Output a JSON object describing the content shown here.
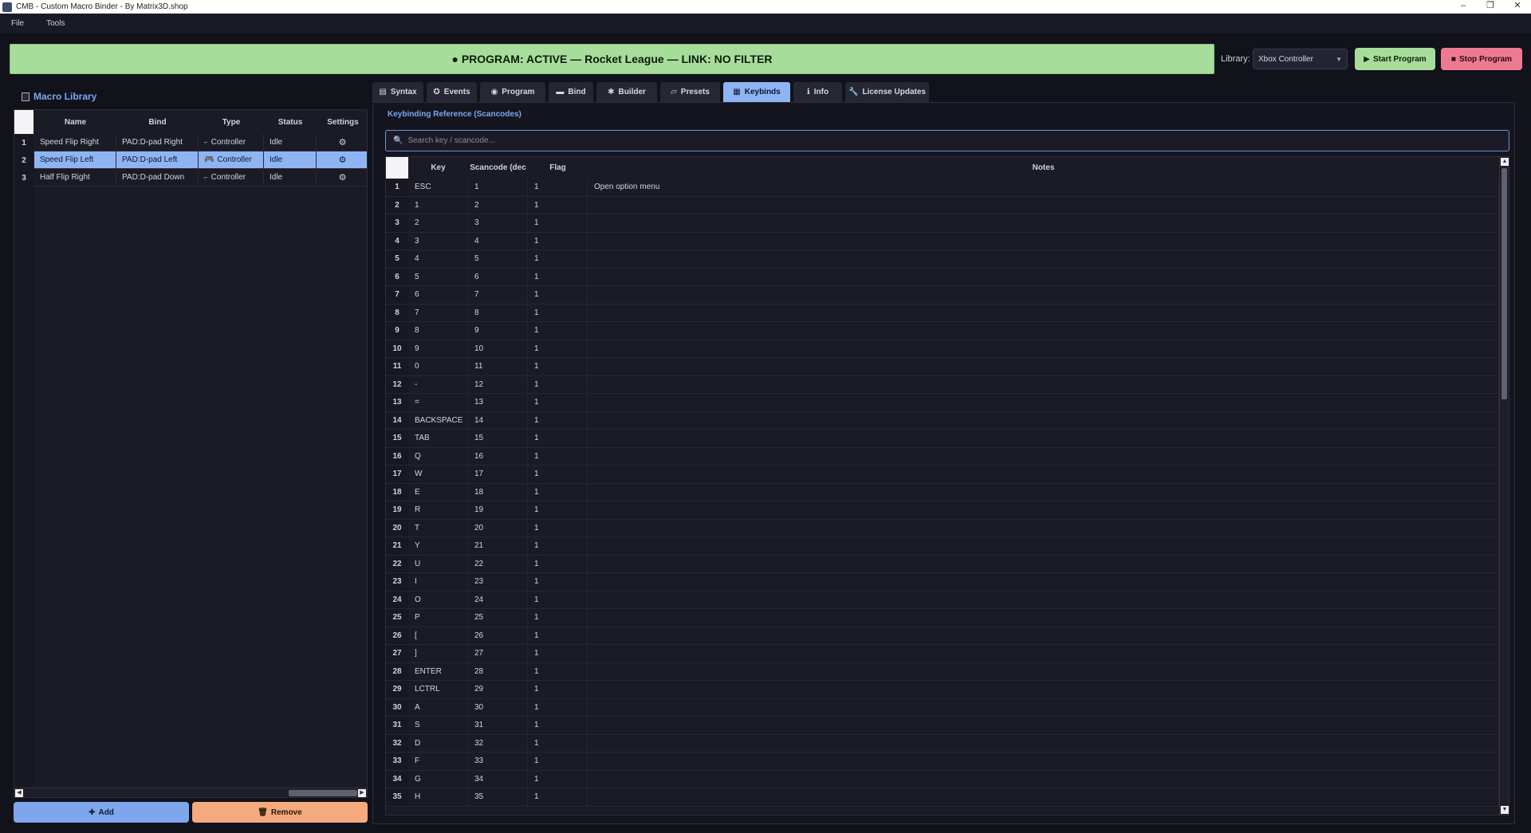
{
  "window": {
    "title": "CMB - Custom Macro Binder - By Matrix3D.shop",
    "controls": [
      "–",
      "❐",
      "✕"
    ]
  },
  "menu": [
    "File",
    "Tools"
  ],
  "status": {
    "text": "● PROGRAM: ACTIVE — Rocket League — LINK: NO FILTER",
    "color": "#a7dd9a"
  },
  "library_selector": {
    "label": "Library:",
    "value": "Xbox Controller"
  },
  "buttons": {
    "start": "Start Program",
    "stop": "Stop Program",
    "add": "Add",
    "remove": "Remove"
  },
  "macro_library": {
    "title": "Macro Library",
    "columns": [
      "Name",
      "Bind",
      "Type",
      "Status",
      "Settings"
    ],
    "rows": [
      {
        "num": "1",
        "name": "Speed Flip Right",
        "bind": "PAD:D-pad Right",
        "type": "Controller",
        "status": "Idle",
        "selected": false
      },
      {
        "num": "2",
        "name": "Speed Flip Left",
        "bind": "PAD:D-pad Left",
        "type": "Controller",
        "status": "Idle",
        "selected": true
      },
      {
        "num": "3",
        "name": "Half Flip Right",
        "bind": "PAD:D-pad Down",
        "type": "Controller",
        "status": "Idle",
        "selected": false
      }
    ]
  },
  "tabs": [
    {
      "label": "Syntax",
      "icon": "▤",
      "active": false
    },
    {
      "label": "Events",
      "icon": "✪",
      "active": false
    },
    {
      "label": "Program",
      "icon": "◉",
      "active": false
    },
    {
      "label": "Bind",
      "icon": "▬",
      "active": false
    },
    {
      "label": "Builder",
      "icon": "✱",
      "active": false
    },
    {
      "label": "Presets",
      "icon": "▱",
      "active": false
    },
    {
      "label": "Keybinds",
      "icon": "▦",
      "active": true
    },
    {
      "label": "Info",
      "icon": "ℹ",
      "active": false
    },
    {
      "label": "License  Updates",
      "icon": "🔧",
      "active": false
    }
  ],
  "keybinds": {
    "group_title": "Keybinding Reference (Scancodes)",
    "search_placeholder": "Search key / scancode...",
    "columns": [
      "Key",
      "Scancode (dec",
      "Flag",
      "Notes"
    ],
    "rows": [
      [
        "1",
        "ESC",
        "1",
        "1",
        "Open option menu"
      ],
      [
        "2",
        "1",
        "2",
        "1",
        ""
      ],
      [
        "3",
        "2",
        "3",
        "1",
        ""
      ],
      [
        "4",
        "3",
        "4",
        "1",
        ""
      ],
      [
        "5",
        "4",
        "5",
        "1",
        ""
      ],
      [
        "6",
        "5",
        "6",
        "1",
        ""
      ],
      [
        "7",
        "6",
        "7",
        "1",
        ""
      ],
      [
        "8",
        "7",
        "8",
        "1",
        ""
      ],
      [
        "9",
        "8",
        "9",
        "1",
        ""
      ],
      [
        "10",
        "9",
        "10",
        "1",
        ""
      ],
      [
        "11",
        "0",
        "11",
        "1",
        ""
      ],
      [
        "12",
        "-",
        "12",
        "1",
        ""
      ],
      [
        "13",
        "=",
        "13",
        "1",
        ""
      ],
      [
        "14",
        "BACKSPACE",
        "14",
        "1",
        ""
      ],
      [
        "15",
        "TAB",
        "15",
        "1",
        ""
      ],
      [
        "16",
        "Q",
        "16",
        "1",
        ""
      ],
      [
        "17",
        "W",
        "17",
        "1",
        ""
      ],
      [
        "18",
        "E",
        "18",
        "1",
        ""
      ],
      [
        "19",
        "R",
        "19",
        "1",
        ""
      ],
      [
        "20",
        "T",
        "20",
        "1",
        ""
      ],
      [
        "21",
        "Y",
        "21",
        "1",
        ""
      ],
      [
        "22",
        "U",
        "22",
        "1",
        ""
      ],
      [
        "23",
        "I",
        "23",
        "1",
        ""
      ],
      [
        "24",
        "O",
        "24",
        "1",
        ""
      ],
      [
        "25",
        "P",
        "25",
        "1",
        ""
      ],
      [
        "26",
        "[",
        "26",
        "1",
        ""
      ],
      [
        "27",
        "]",
        "27",
        "1",
        ""
      ],
      [
        "28",
        "ENTER",
        "28",
        "1",
        ""
      ],
      [
        "29",
        "LCTRL",
        "29",
        "1",
        ""
      ],
      [
        "30",
        "A",
        "30",
        "1",
        ""
      ],
      [
        "31",
        "S",
        "31",
        "1",
        ""
      ],
      [
        "32",
        "D",
        "32",
        "1",
        ""
      ],
      [
        "33",
        "F",
        "33",
        "1",
        ""
      ],
      [
        "34",
        "G",
        "34",
        "1",
        ""
      ],
      [
        "35",
        "H",
        "35",
        "1",
        ""
      ]
    ]
  }
}
